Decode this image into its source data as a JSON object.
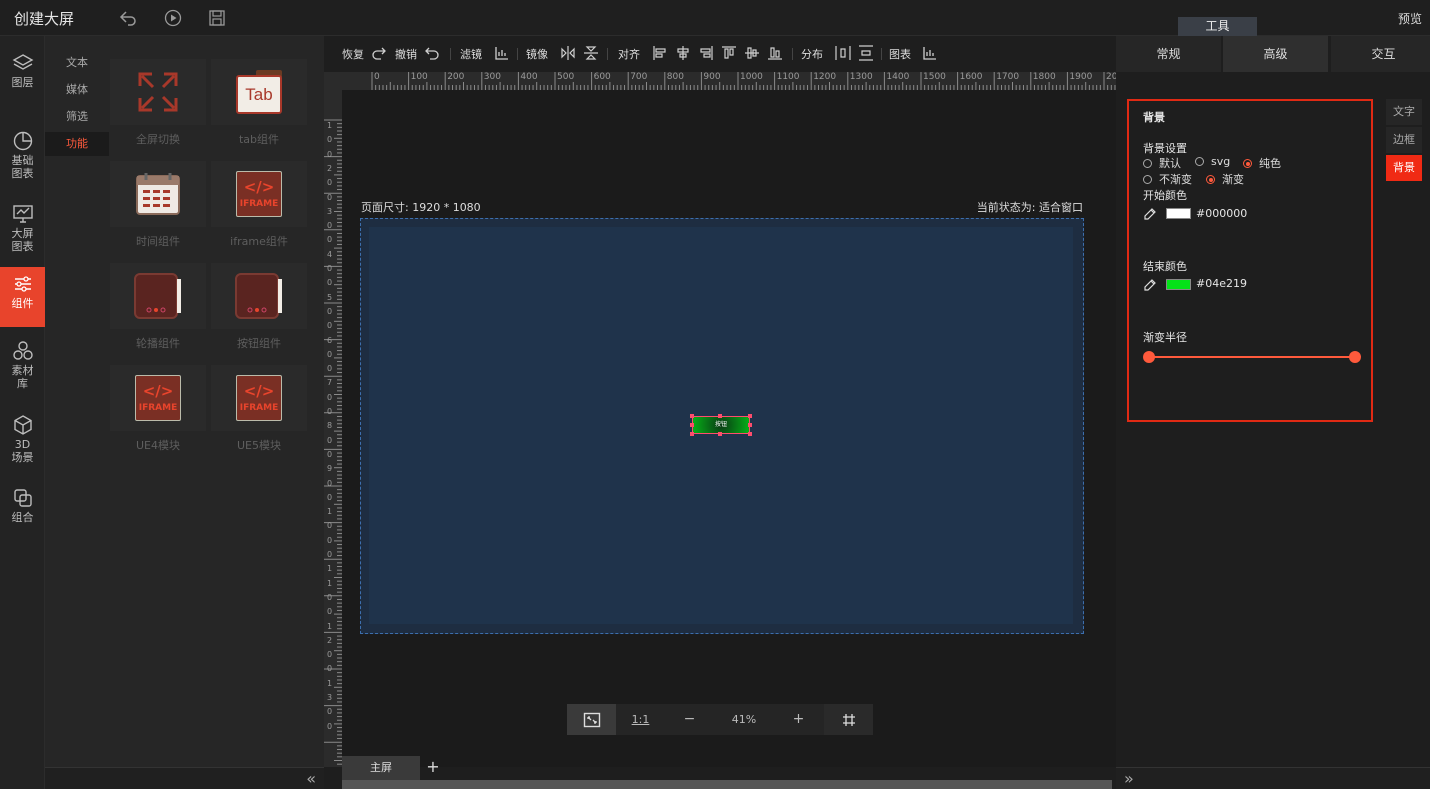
{
  "topbar": {
    "title": "创建大屏",
    "preview": "预览",
    "tool_tab": "工具"
  },
  "leftnav": [
    {
      "label": "图层",
      "icon": "layers-icon"
    },
    {
      "label": "基础\n图表",
      "icon": "pie-chart-icon"
    },
    {
      "label": "大屏\n图表",
      "icon": "monitor-chart-icon"
    },
    {
      "label": "组件",
      "icon": "sliders-icon",
      "active": true
    },
    {
      "label": "素材\n库",
      "icon": "hexagons-icon"
    },
    {
      "label": "3D\n场景",
      "icon": "cube-icon"
    },
    {
      "label": "组合",
      "icon": "combine-icon"
    }
  ],
  "subcats": [
    "文本",
    "媒体",
    "筛选",
    "功能"
  ],
  "components": [
    {
      "label": "全屏切换",
      "icon": "fullscreen-icon"
    },
    {
      "label": "tab组件",
      "icon": "tab-icon"
    },
    {
      "label": "时间组件",
      "icon": "calendar-icon"
    },
    {
      "label": "iframe组件",
      "icon": "iframe-icon"
    },
    {
      "label": "轮播组件",
      "icon": "carousel-icon"
    },
    {
      "label": "按钮组件",
      "icon": "button-component-icon"
    },
    {
      "label": "UE4模块",
      "icon": "iframe-icon"
    },
    {
      "label": "UE5模块",
      "icon": "iframe-icon"
    }
  ],
  "thumbs": {
    "tab": "Tab",
    "iframe": "IFRAME",
    "code": "</>"
  },
  "toolbar": {
    "redo": "恢复",
    "undo": "撤销",
    "filter": "滤镜",
    "mirror": "镜像",
    "align": "对齐",
    "distribute": "分布",
    "chart": "图表"
  },
  "ruler_h": [
    "0",
    "100",
    "200",
    "300",
    "400",
    "500",
    "600",
    "700",
    "800",
    "900",
    "1000",
    "1100",
    "1200",
    "1300",
    "1400",
    "1500",
    "1600",
    "1700",
    "1800",
    "1900",
    "20"
  ],
  "ruler_v": [
    "1",
    "0",
    "0",
    "2",
    "0",
    "0",
    "3",
    "0",
    "0",
    "4",
    "0",
    "0",
    "5",
    "0",
    "0",
    "6",
    "0",
    "0",
    "7",
    "0",
    "0",
    "8",
    "0",
    "0",
    "9",
    "0",
    "0",
    "1",
    "0",
    "0",
    "0",
    "1",
    "1",
    "0",
    "0",
    "1",
    "2",
    "0",
    "0",
    "1",
    "3",
    "0",
    "0"
  ],
  "canvas": {
    "page_size": "页面尺寸: 1920 * 1080",
    "current_state": "当前状态为: 适合窗口",
    "button_text": "按钮"
  },
  "zoom": {
    "fit_label": "fit",
    "one_to_one": "1:1",
    "minus": "−",
    "percent": "41%",
    "plus": "+"
  },
  "screen_tabs": {
    "main": "主屏",
    "add": "+"
  },
  "right": {
    "tabs": [
      "常规",
      "高级",
      "交互"
    ],
    "active_tab": 1,
    "section_title": "背景",
    "bg_setting": "背景设置",
    "bg_options": [
      "默认",
      "svg",
      "纯色"
    ],
    "bg_selected": 2,
    "grad_options": [
      "不渐变",
      "渐变"
    ],
    "grad_selected": 1,
    "start_color_label": "开始颜色",
    "start_color": "#000000",
    "start_color_swatch": "#ffffff",
    "end_color_label": "结束颜色",
    "end_color": "#04e219",
    "end_color_swatch": "#04e219",
    "radius_label": "渐变半径",
    "side_tabs": [
      "文字",
      "边框",
      "背景"
    ],
    "side_active": 2
  },
  "colors": {
    "accent": "#e8442c",
    "highlight": "#e02a14"
  }
}
